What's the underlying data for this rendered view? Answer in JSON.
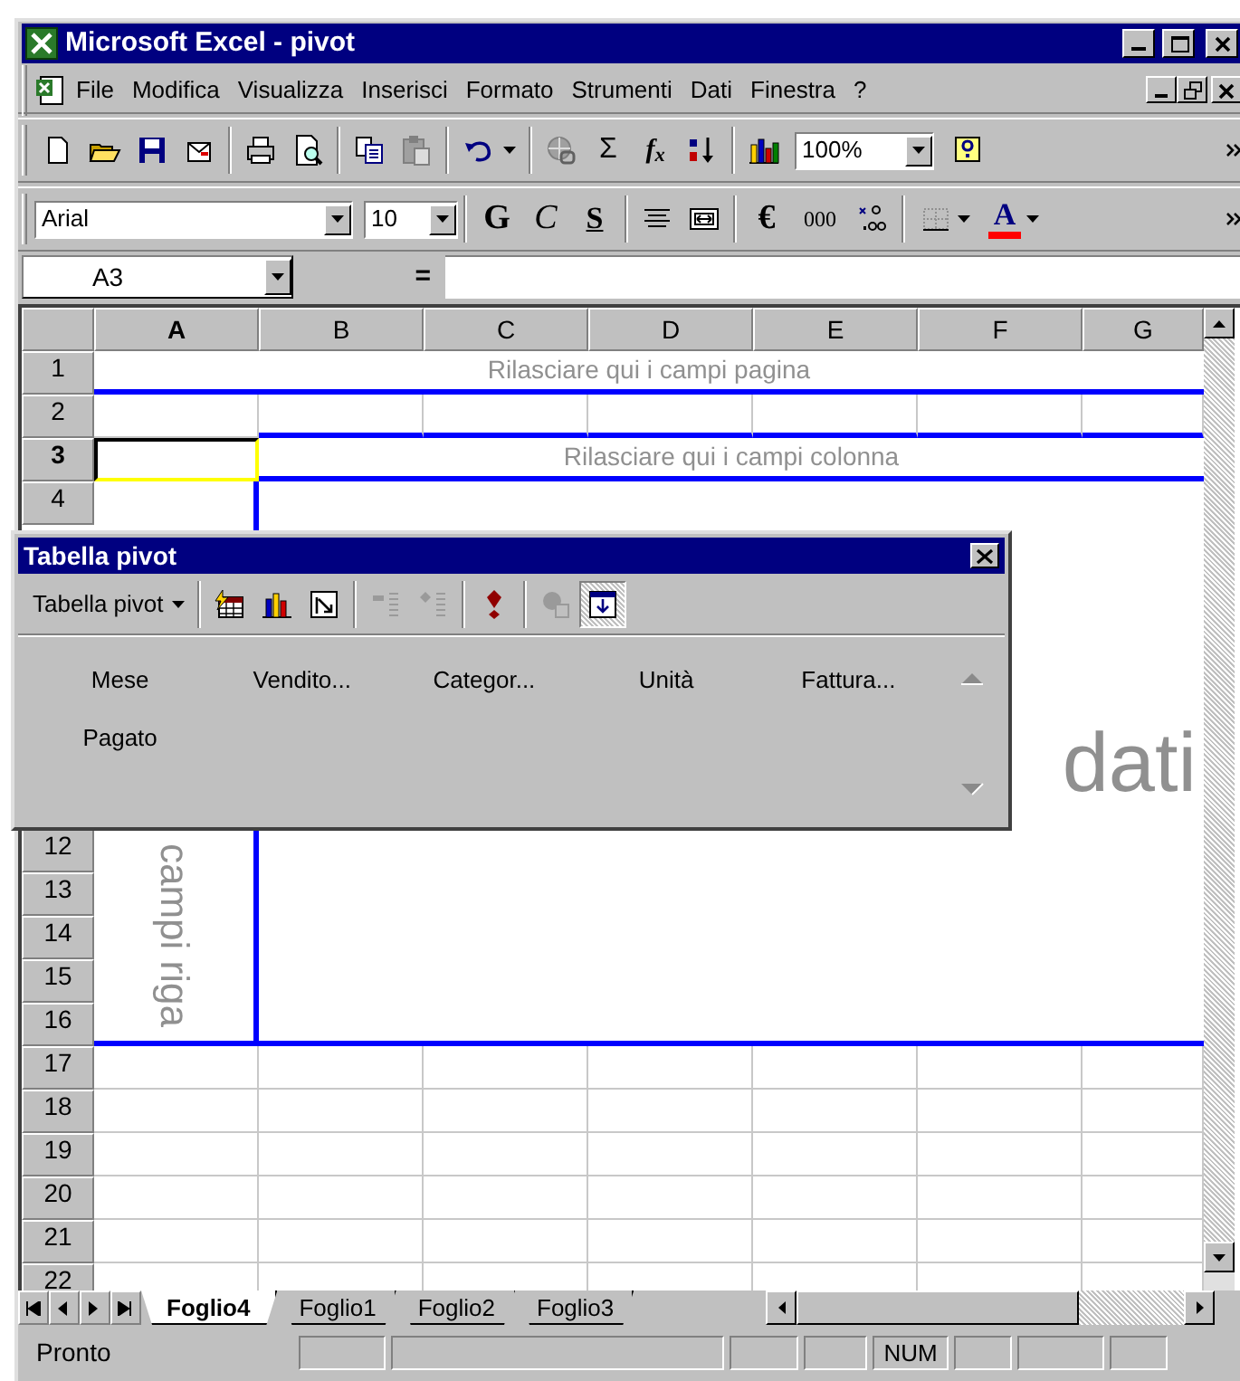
{
  "window": {
    "title": "Microsoft Excel - pivot"
  },
  "menu": [
    {
      "label": "File"
    },
    {
      "label": "Modifica"
    },
    {
      "label": "Visualizza"
    },
    {
      "label": "Inserisci"
    },
    {
      "label": "Formato"
    },
    {
      "label": "Strumenti"
    },
    {
      "label": "Dati"
    },
    {
      "label": "Finestra"
    },
    {
      "label": "?"
    }
  ],
  "standard_toolbar": {
    "autosum": "Σ",
    "function": "f$_{x}$",
    "zoom": "100%"
  },
  "formatting_toolbar": {
    "font": "Arial",
    "size": "10",
    "bold": "G",
    "italic": "C",
    "underline": "S",
    "euro": "€",
    "thousands": "000",
    "font_color": "A"
  },
  "formula_bar": {
    "name_box": "A3",
    "equals": "="
  },
  "sheet": {
    "columns": [
      {
        "label": "A",
        "selected": true
      },
      {
        "label": "B",
        "selected": false
      },
      {
        "label": "C",
        "selected": false
      },
      {
        "label": "D",
        "selected": false
      },
      {
        "label": "E",
        "selected": false
      },
      {
        "label": "F",
        "selected": false
      },
      {
        "label": "G",
        "selected": false
      }
    ],
    "row_headers": [
      {
        "label": "1",
        "selected": false
      },
      {
        "label": "2",
        "selected": false
      },
      {
        "label": "3",
        "selected": true
      },
      {
        "label": "4",
        "selected": false
      },
      {
        "label": "12",
        "selected": false
      },
      {
        "label": "13",
        "selected": false
      },
      {
        "label": "14",
        "selected": false
      },
      {
        "label": "15",
        "selected": false
      },
      {
        "label": "16",
        "selected": false
      },
      {
        "label": "17",
        "selected": false
      },
      {
        "label": "18",
        "selected": false
      },
      {
        "label": "19",
        "selected": false
      },
      {
        "label": "20",
        "selected": false
      },
      {
        "label": "21",
        "selected": false
      },
      {
        "label": "22",
        "selected": false
      }
    ],
    "page_area": "Rilasciare qui i campi pagina",
    "column_area": "Rilasciare qui i campi colonna",
    "row_area": "campi riga",
    "data_area": "dati"
  },
  "pivot_toolbar": {
    "title": "Tabella pivot",
    "menu": "Tabella pivot",
    "buttons": [
      {
        "disabled": false,
        "pressed": false
      },
      {
        "disabled": false,
        "pressed": false
      },
      {
        "disabled": false,
        "pressed": false
      },
      {
        "disabled": true,
        "pressed": false
      },
      {
        "disabled": true,
        "pressed": false
      },
      {
        "disabled": false,
        "pressed": false
      },
      {
        "disabled": true,
        "pressed": false
      },
      {
        "disabled": false,
        "pressed": true
      }
    ],
    "fields": [
      "Mese",
      "Vendito...",
      "Categor...",
      "Unità",
      "Fattura...",
      "Pagato"
    ]
  },
  "sheet_tabs": [
    {
      "label": "Foglio4",
      "selected": true
    },
    {
      "label": "Foglio1",
      "selected": false
    },
    {
      "label": "Foglio2",
      "selected": false
    },
    {
      "label": "Foglio3",
      "selected": false
    }
  ],
  "status_bar": {
    "message": "Pronto",
    "num": "NUM"
  }
}
